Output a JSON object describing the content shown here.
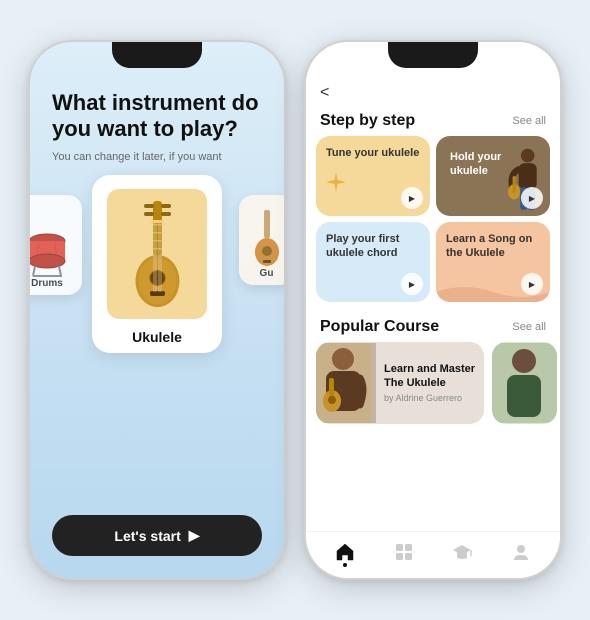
{
  "left_phone": {
    "title": "What instrument do you want to play?",
    "subtitle": "You can change it later, if you want",
    "selected_instrument": "Ukulele",
    "side_instruments": [
      "Drums",
      "Gu"
    ],
    "start_button": "Let's start"
  },
  "right_phone": {
    "back": "<",
    "step_by_step": {
      "title": "Step by step",
      "see_all": "See all",
      "steps": [
        {
          "label": "Tune your ukulele",
          "color": "yellow"
        },
        {
          "label": "Hold your ukulele",
          "color": "image"
        },
        {
          "label": "Play your first ukulele chord",
          "color": "blue"
        },
        {
          "label": "Learn a Song on the Ukulele",
          "color": "peach"
        }
      ]
    },
    "popular_course": {
      "title": "Popular Course",
      "see_all": "See all",
      "courses": [
        {
          "title": "Learn and Master The Ukulele",
          "author": "by Aldrine Guerrero"
        }
      ]
    },
    "nav_icons": [
      "home",
      "grid",
      "graduation-cap",
      "person"
    ]
  }
}
